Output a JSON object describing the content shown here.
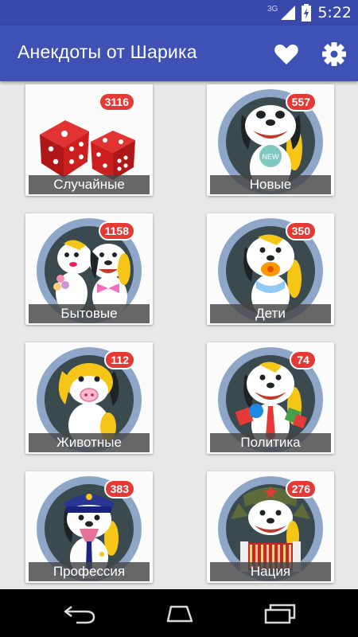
{
  "status_bar": {
    "network": "3G",
    "time": "5:22",
    "icons": [
      "signal-icon",
      "battery-charging-icon"
    ]
  },
  "app_bar": {
    "title": "Анекдоты от Шарика",
    "icons": [
      "heart-icon",
      "gear-icon"
    ]
  },
  "categories": [
    {
      "label": "Случайные",
      "count": "3116",
      "art": "dice"
    },
    {
      "label": "Новые",
      "count": "557",
      "art": "dog-new"
    },
    {
      "label": "Бытовые",
      "count": "1158",
      "art": "dog-couple"
    },
    {
      "label": "Дети",
      "count": "350",
      "art": "dog-pacifier"
    },
    {
      "label": "Животные",
      "count": "112",
      "art": "dog-pig"
    },
    {
      "label": "Политика",
      "count": "74",
      "art": "dog-tie"
    },
    {
      "label": "Профессия",
      "count": "383",
      "art": "dog-police"
    },
    {
      "label": "Нация",
      "count": "276",
      "art": "dog-accordion"
    }
  ],
  "nav_bar": {
    "icons": [
      "back-icon",
      "home-icon",
      "recents-icon"
    ]
  },
  "colors": {
    "primary": "#3f51b5",
    "primary_dark": "#3949ab",
    "badge": "#e53935",
    "ring": "#8ea7c9",
    "ring_inner": "#3b4a4e"
  }
}
